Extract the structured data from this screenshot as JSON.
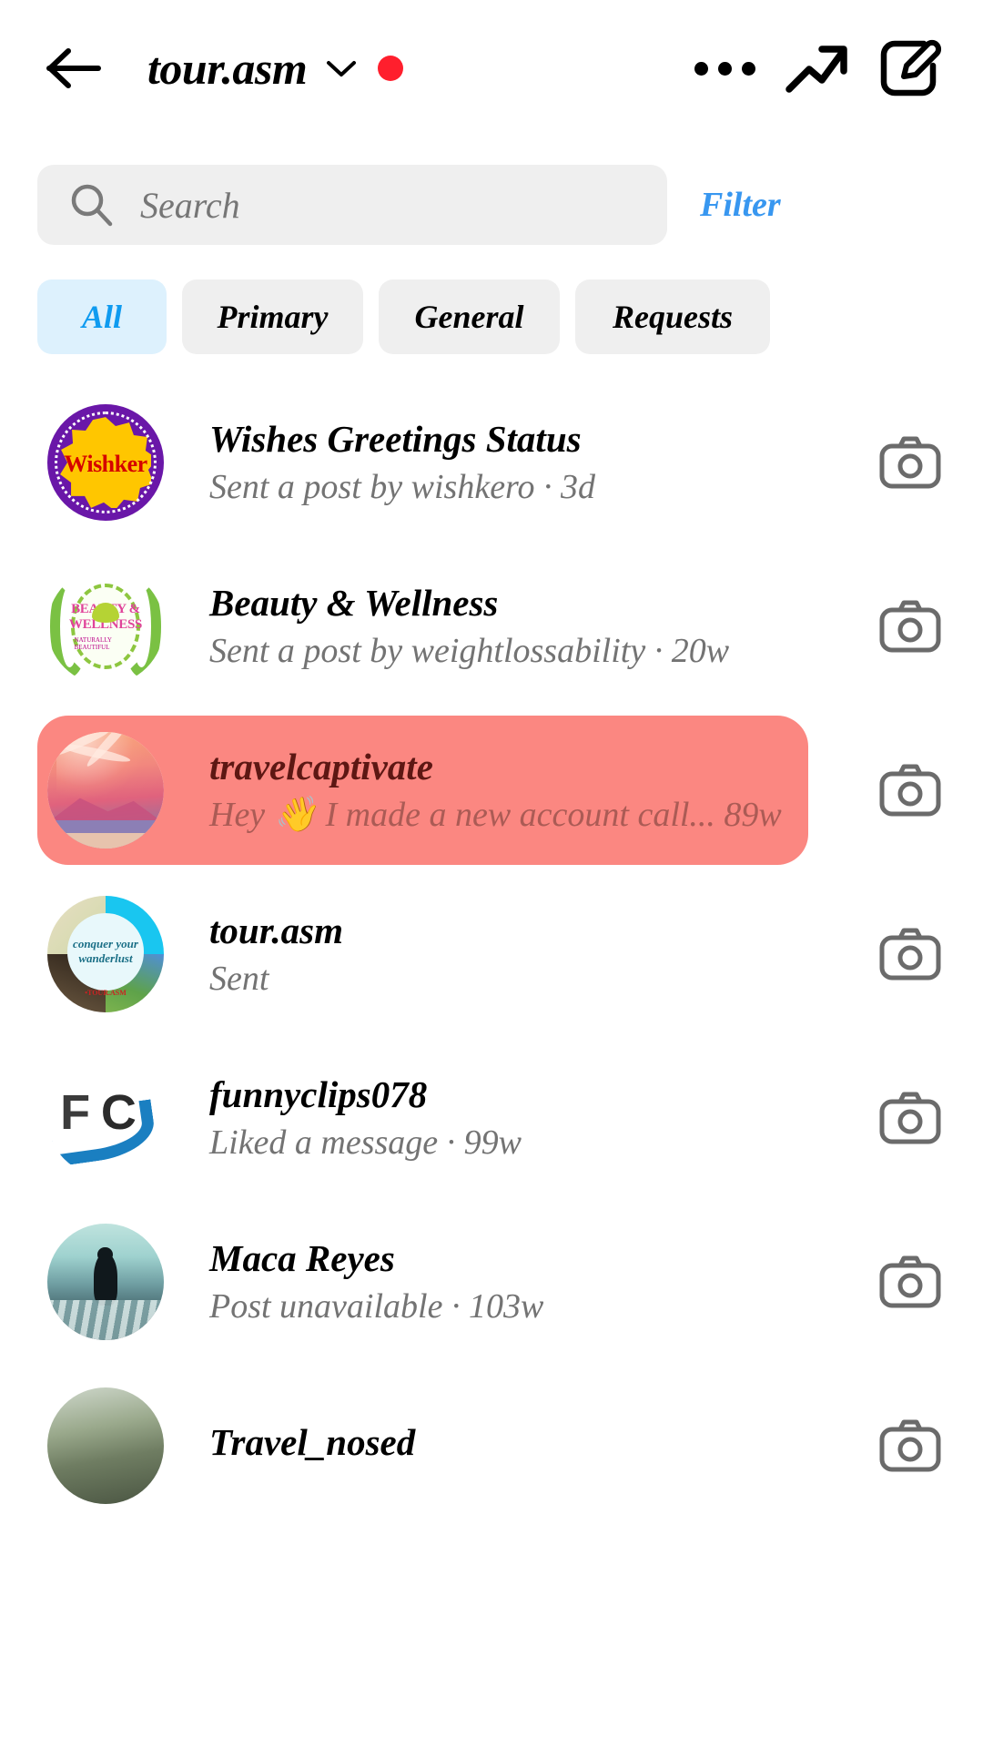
{
  "header": {
    "back_icon": "back-arrow-icon",
    "account_name": "tour.asm",
    "chevron_icon": "chevron-down-icon",
    "unread_badge": "",
    "menu_icon": "more-options-icon",
    "insights_icon": "trending-arrow-icon",
    "compose_icon": "compose-message-icon"
  },
  "search": {
    "placeholder": "Search",
    "icon": "search-icon",
    "filter_label": "Filter"
  },
  "tabs": [
    {
      "label": "All",
      "active": true
    },
    {
      "label": "Primary",
      "active": false
    },
    {
      "label": "General",
      "active": false
    },
    {
      "label": "Requests",
      "active": false
    }
  ],
  "conversations": [
    {
      "name": "Wishes Greetings Status",
      "preview": "Sent a post by wishkero · 3d",
      "avatar": "wishker-logo-avatar",
      "avatar_text": "Wishker",
      "highlighted": false,
      "camera_icon": "camera-icon"
    },
    {
      "name": "Beauty & Wellness",
      "preview": "Sent a post by weightlossability · 20w",
      "avatar": "beauty-wellness-logo-avatar",
      "avatar_text": "BEAUTY & WELLNESS",
      "avatar_subtext": "NATURALLY BEAUTIFUL",
      "highlighted": false,
      "camera_icon": "camera-icon"
    },
    {
      "name": "travelcaptivate",
      "preview": "Hey 👋 I made a new account call...  89w",
      "avatar": "tropical-beach-avatar",
      "highlighted": true,
      "camera_icon": "camera-icon"
    },
    {
      "name": "tour.asm",
      "preview": "Sent",
      "avatar": "tour-asm-avatar",
      "avatar_text": "conquer your wanderlust",
      "avatar_subtext": "•TOUR.ASM",
      "highlighted": false,
      "camera_icon": "camera-icon"
    },
    {
      "name": "funnyclips078",
      "preview": "Liked a message · 99w",
      "avatar": "fc-logo-avatar",
      "avatar_text": "FC",
      "highlighted": false,
      "camera_icon": "camera-icon"
    },
    {
      "name": "Maca Reyes",
      "preview": "Post unavailable · 103w",
      "avatar": "beach-silhouette-avatar",
      "highlighted": false,
      "camera_icon": "camera-icon"
    },
    {
      "name": "Travel_nosed",
      "preview": "",
      "avatar": "landscape-avatar",
      "highlighted": false,
      "camera_icon": "camera-icon"
    }
  ],
  "colors": {
    "accent_blue": "#0f9bf0",
    "filter_blue": "#3897f0",
    "tab_active_bg": "#ddf1fd",
    "tab_bg": "#efefef",
    "search_bg": "#efefef",
    "highlight_red": "#fb8781",
    "badge_red": "#ff1f2d",
    "subtext_gray": "#737373"
  }
}
